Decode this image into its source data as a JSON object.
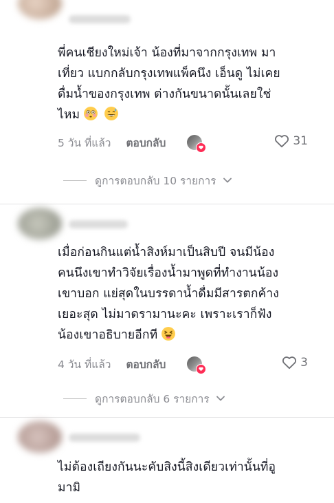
{
  "comments": [
    {
      "text_lines": [
        "พี่คนเชียงใหม่เจ้า น้องที่มาจากกรุงเทพ มา",
        "เที่ยว แบกกลับกรุงเทพแพ็คนึง เอ็นดู ไม่เคย",
        "ดื่มน้ำของกรุงเทพ ต่างกันขนาดนั้นเลยใช่",
        "ไหม"
      ],
      "emojis": [
        "flushed-face",
        "smiling-face-with-sweat"
      ],
      "time": "5 วัน ที่แล้ว",
      "reply_label": "ตอบกลับ",
      "likes": "31",
      "view_replies": "ดูการตอบกลับ 10 รายการ"
    },
    {
      "text_lines": [
        "เมื่อก่อนกินแต่น้ำสิงห์มาเป็นสิบปี จนมีน้อง",
        "คนนึงเขาทำวิจัยเรื่องน้ำมาพูดที่ทำงานน้อง",
        "เขาบอก แย่สุดในบรรดาน้ำดื่มมีสารตกค้าง",
        "เยอะสุด ไม่มาดรามานะคะ เพราะเราก็ฟัง",
        "น้องเขาอธิบายอีกที"
      ],
      "emojis": [
        "squinting-laughing-face"
      ],
      "time": "4 วัน ที่แล้ว",
      "reply_label": "ตอบกลับ",
      "likes": "3",
      "view_replies": "ดูการตอบกลับ 6 รายการ"
    },
    {
      "text_lines": [
        "ไม่ต้องเถียงกันนะคับสิงนี้สิงเดียวเท่านั้นที่อู",
        "มามิ"
      ]
    }
  ],
  "colors": {
    "text": "#161823",
    "muted": "#8a8b91",
    "like_badge": "#fe2c55"
  }
}
